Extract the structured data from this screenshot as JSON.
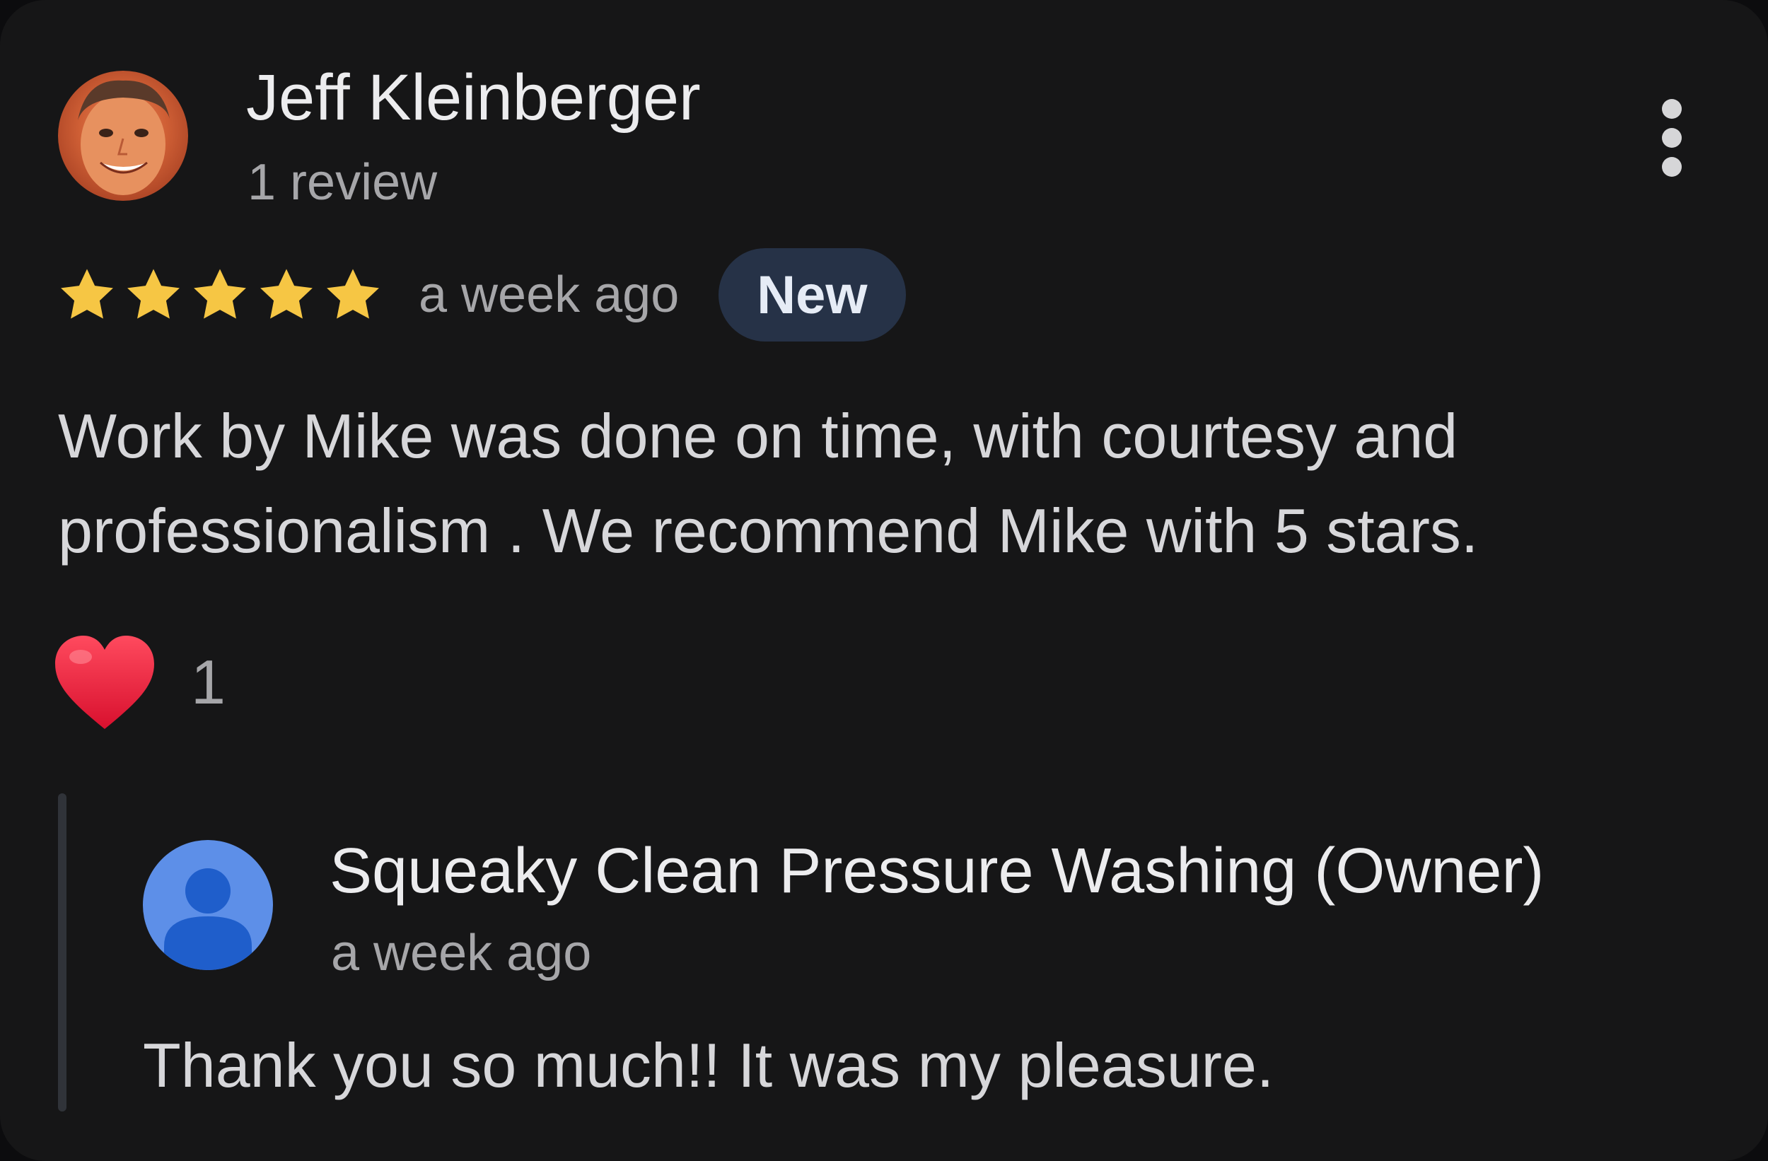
{
  "review": {
    "reviewer_name": "Jeff Kleinberger",
    "reviewer_meta": "1 review",
    "rating": 5,
    "rating_max": 5,
    "time": "a week ago",
    "badge": "New",
    "text": "Work by Mike was done on time, with courtesy and professionalism . We recommend Mike with 5 stars.",
    "reaction_count": "1",
    "reaction_icon": "heart-icon",
    "menu_icon": "more-vert-icon"
  },
  "reply": {
    "owner_name": "Squeaky Clean Pressure Washing (Owner)",
    "time": "a week ago",
    "text": "Thank you so much!! It was my pleasure.",
    "avatar_icon": "person-icon"
  },
  "colors": {
    "background": "#161617",
    "star": "#f6c644",
    "badge_bg": "#263247",
    "heart": "#e8213f",
    "owner_avatar": "#5d8fe8"
  }
}
